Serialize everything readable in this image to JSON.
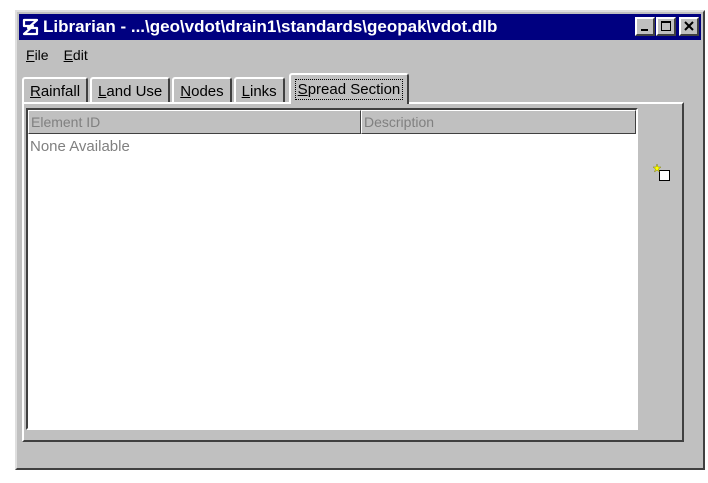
{
  "window": {
    "title": "Librarian - ...\\geo\\vdot\\drain1\\standards\\geopak\\vdot.dlb"
  },
  "menu": [
    {
      "label": "File",
      "mnemonic": "F",
      "rest": "ile"
    },
    {
      "label": "Edit",
      "mnemonic": "E",
      "rest": "dit"
    }
  ],
  "tabs": [
    {
      "label": "Rainfall",
      "mnemonic": "R",
      "rest": "ainfall"
    },
    {
      "label": "Land Use",
      "mnemonic": "L",
      "rest": "and Use"
    },
    {
      "label": "Nodes",
      "mnemonic": "N",
      "rest": "odes"
    },
    {
      "label": "Links",
      "mnemonic": "L",
      "rest": "inks"
    },
    {
      "label": "Spread Section",
      "mnemonic": "S",
      "rest": "pread Section"
    }
  ],
  "list": {
    "columns": [
      "Element ID",
      "Description"
    ],
    "empty_text": "None Available"
  },
  "icons": {
    "app": "geopak-icon",
    "new": "new-element-icon"
  },
  "colors": {
    "titlebar": "#000080",
    "face": "#c0c0c0",
    "disabled_text": "#808080"
  }
}
